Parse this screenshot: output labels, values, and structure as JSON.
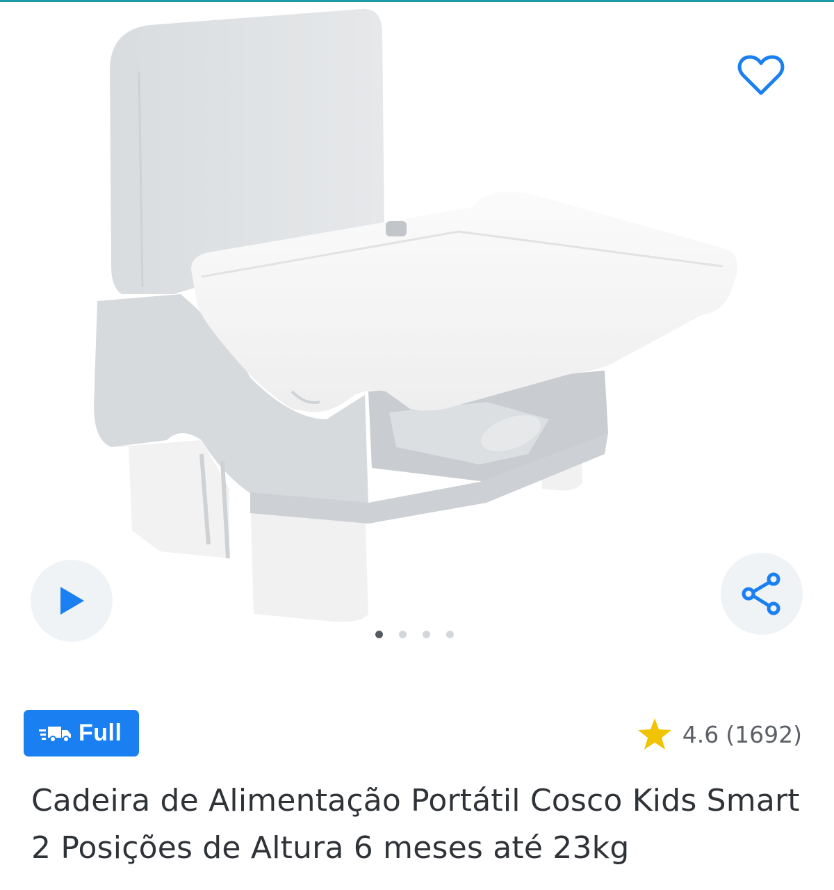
{
  "colors": {
    "accent": "#1a7ff0",
    "star": "#f2c300",
    "text": "#2f3338",
    "muted": "#5b5f66"
  },
  "gallery": {
    "image_alt": "Cadeira de Alimentação Portátil Cosco Kids",
    "favorite_icon": "heart-outline-icon",
    "play_icon": "play-icon",
    "share_icon": "share-icon",
    "page_indicator": {
      "total": 4,
      "active": 1
    }
  },
  "badge": {
    "icon": "fast-truck-icon",
    "label": "Full"
  },
  "rating": {
    "icon": "star-icon",
    "value": "4.6",
    "count": "(1692)"
  },
  "product": {
    "title": "Cadeira de Alimentação Portátil Cosco Kids Smart 2 Posições de Altura 6 meses até 23kg"
  }
}
